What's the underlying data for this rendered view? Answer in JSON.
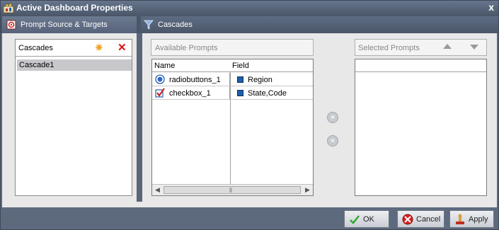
{
  "window": {
    "title": "Active Dashboard Properties",
    "close_glyph": "x"
  },
  "tabs": [
    {
      "label": "Prompt Source & Targets",
      "icon": "prompt-source-icon"
    },
    {
      "label": "Cascades",
      "icon": "cascades-icon"
    }
  ],
  "cascades_panel": {
    "header": "Cascades",
    "add_glyph": "✷",
    "delete_glyph": "✕",
    "items": [
      "Cascade1"
    ]
  },
  "available_prompts": {
    "header": "Available Prompts",
    "columns": [
      "Name",
      "Field"
    ],
    "rows": [
      {
        "name": "radiobuttons_1",
        "name_icon": "radio-button-icon",
        "field": "Region",
        "field_icon": "field-icon"
      },
      {
        "name": "checkbox_1",
        "name_icon": "checkbox-icon",
        "field": "State,Code",
        "field_icon": "field-icon"
      }
    ]
  },
  "move": {
    "add_glyph": "»",
    "remove_glyph": "«"
  },
  "selected_prompts": {
    "header": "Selected Prompts"
  },
  "footer": {
    "ok_label": "OK",
    "cancel_label": "Cancel",
    "apply_label": "Apply"
  },
  "colors": {
    "chrome": "#5d6a7e",
    "titlebar": "#4c596c",
    "panel_bg": "#e8e8e8"
  }
}
